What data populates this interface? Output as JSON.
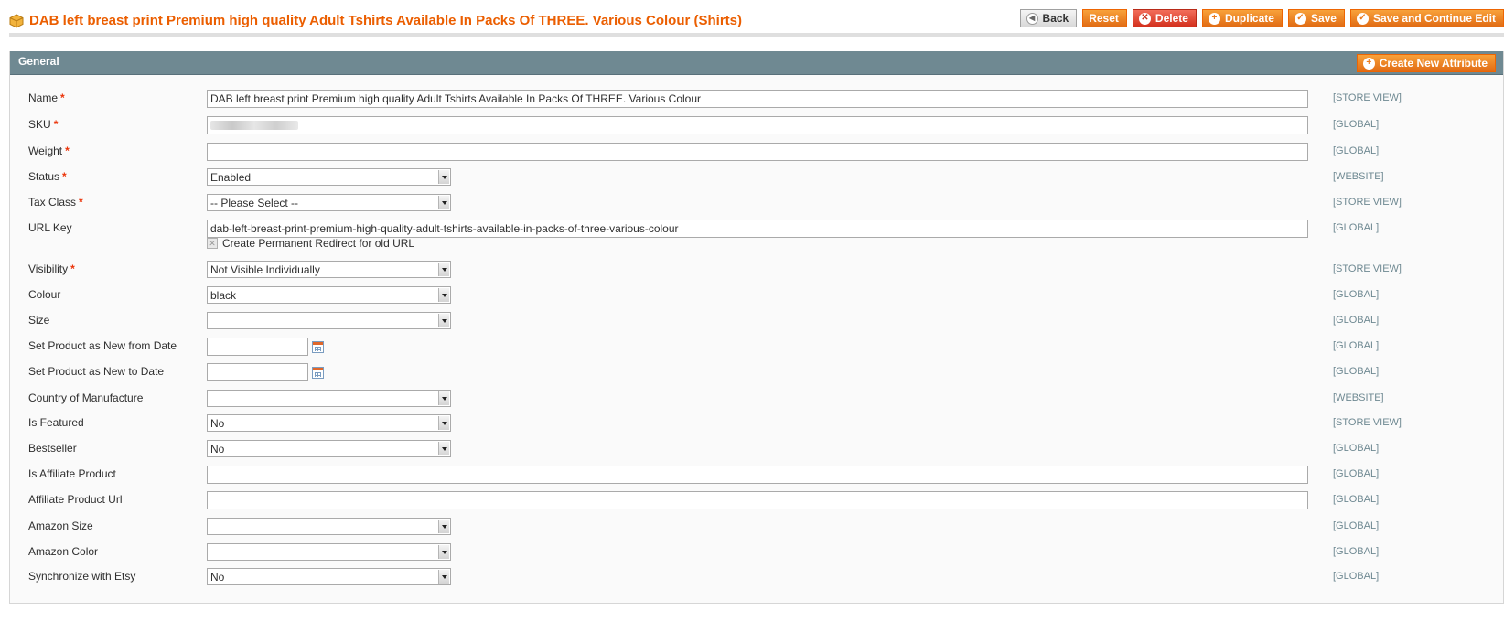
{
  "header": {
    "title": "DAB left breast print Premium high quality Adult Tshirts Available In Packs Of THREE. Various Colour (Shirts)",
    "icon": "package-icon",
    "buttons": {
      "back": "Back",
      "reset": "Reset",
      "delete": "Delete",
      "duplicate": "Duplicate",
      "save": "Save",
      "save_continue": "Save and Continue Edit"
    }
  },
  "section": {
    "title": "General",
    "create_attribute": "Create New Attribute"
  },
  "fields": {
    "name": {
      "label": "Name",
      "value": "DAB left breast print Premium high quality Adult Tshirts Available In Packs Of THREE. Various Colour",
      "scope": "[STORE VIEW]"
    },
    "sku": {
      "label": "SKU",
      "value": "",
      "scope": "[GLOBAL]"
    },
    "weight": {
      "label": "Weight",
      "value": "",
      "scope": "[GLOBAL]"
    },
    "status": {
      "label": "Status",
      "value": "Enabled",
      "scope": "[WEBSITE]"
    },
    "tax_class": {
      "label": "Tax Class",
      "value": "-- Please Select --",
      "scope": "[STORE VIEW]"
    },
    "url_key": {
      "label": "URL Key",
      "value": "dab-left-breast-print-premium-high-quality-adult-tshirts-available-in-packs-of-three-various-colour",
      "scope": "[GLOBAL]",
      "redirect_label": "Create Permanent Redirect for old URL",
      "redirect_checked": true
    },
    "visibility": {
      "label": "Visibility",
      "value": "Not Visible Individually",
      "scope": "[STORE VIEW]"
    },
    "colour": {
      "label": "Colour",
      "value": "black",
      "scope": "[GLOBAL]"
    },
    "size": {
      "label": "Size",
      "value": "",
      "scope": "[GLOBAL]"
    },
    "new_from": {
      "label": "Set Product as New from Date",
      "value": "",
      "scope": "[GLOBAL]"
    },
    "new_to": {
      "label": "Set Product as New to Date",
      "value": "",
      "scope": "[GLOBAL]"
    },
    "country": {
      "label": "Country of Manufacture",
      "value": "",
      "scope": "[WEBSITE]"
    },
    "featured": {
      "label": "Is Featured",
      "value": "No",
      "scope": "[STORE VIEW]"
    },
    "bestseller": {
      "label": "Bestseller",
      "value": "No",
      "scope": "[GLOBAL]"
    },
    "affiliate": {
      "label": "Is Affiliate Product",
      "value": "",
      "scope": "[GLOBAL]"
    },
    "affiliate_url": {
      "label": "Affiliate Product Url",
      "value": "",
      "scope": "[GLOBAL]"
    },
    "amazon_size": {
      "label": "Amazon Size",
      "value": "",
      "scope": "[GLOBAL]"
    },
    "amazon_color": {
      "label": "Amazon Color",
      "value": "",
      "scope": "[GLOBAL]"
    },
    "etsy": {
      "label": "Synchronize with Etsy",
      "value": "No",
      "scope": "[GLOBAL]"
    }
  },
  "required_marker": "*"
}
